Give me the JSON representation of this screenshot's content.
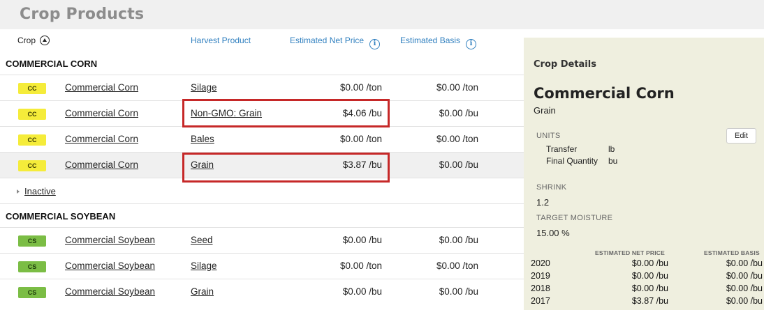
{
  "page": {
    "title": "Crop Products"
  },
  "columns": {
    "crop": "Crop",
    "harvest_product": "Harvest Product",
    "net_price": "Estimated Net Price",
    "basis": "Estimated Basis"
  },
  "groups": [
    {
      "name": "COMMERCIAL CORN",
      "rows": [
        {
          "badge": "CC",
          "crop": "Commercial Corn",
          "product": "Silage",
          "net": "$0.00 /ton",
          "basis": "$0.00 /ton"
        },
        {
          "badge": "CC",
          "crop": "Commercial Corn",
          "product": "Non-GMO: Grain",
          "net": "$4.06 /bu",
          "basis": "$0.00 /bu"
        },
        {
          "badge": "CC",
          "crop": "Commercial Corn",
          "product": "Bales",
          "net": "$0.00 /ton",
          "basis": "$0.00 /ton"
        },
        {
          "badge": "CC",
          "crop": "Commercial Corn",
          "product": "Grain",
          "net": "$3.87 /bu",
          "basis": "$0.00 /bu"
        }
      ],
      "inactive_label": "Inactive"
    },
    {
      "name": "COMMERCIAL SOYBEAN",
      "rows": [
        {
          "badge": "CS",
          "crop": "Commercial Soybean",
          "product": "Seed",
          "net": "$0.00 /bu",
          "basis": "$0.00 /bu"
        },
        {
          "badge": "CS",
          "crop": "Commercial Soybean",
          "product": "Silage",
          "net": "$0.00 /ton",
          "basis": "$0.00 /ton"
        },
        {
          "badge": "CS",
          "crop": "Commercial Soybean",
          "product": "Grain",
          "net": "$0.00 /bu",
          "basis": "$0.00 /bu"
        }
      ]
    }
  ],
  "details": {
    "title": "Crop Details",
    "crop_name": "Commercial Corn",
    "product": "Grain",
    "units_label": "UNITS",
    "edit_label": "Edit",
    "units": [
      {
        "label": "Transfer",
        "value": "lb"
      },
      {
        "label": "Final Quantity",
        "value": "bu"
      }
    ],
    "shrink_label": "SHRINK",
    "shrink_value": "1.2",
    "moisture_label": "TARGET MOISTURE",
    "moisture_value": "15.00 %",
    "history_net_label": "ESTIMATED NET PRICE",
    "history_basis_label": "ESTIMATED BASIS",
    "history": [
      {
        "year": "2020",
        "net": "$0.00 /bu",
        "basis": "$0.00 /bu"
      },
      {
        "year": "2019",
        "net": "$0.00 /bu",
        "basis": "$0.00 /bu"
      },
      {
        "year": "2018",
        "net": "$0.00 /bu",
        "basis": "$0.00 /bu"
      },
      {
        "year": "2017",
        "net": "$3.87 /bu",
        "basis": "$0.00 /bu"
      }
    ]
  },
  "colors": {
    "link_blue": "#2f7fbf",
    "corn_badge": "#f5ec3a",
    "soy_badge": "#7bbd45",
    "highlight": "#c62828",
    "details_bg": "#efefdf"
  }
}
